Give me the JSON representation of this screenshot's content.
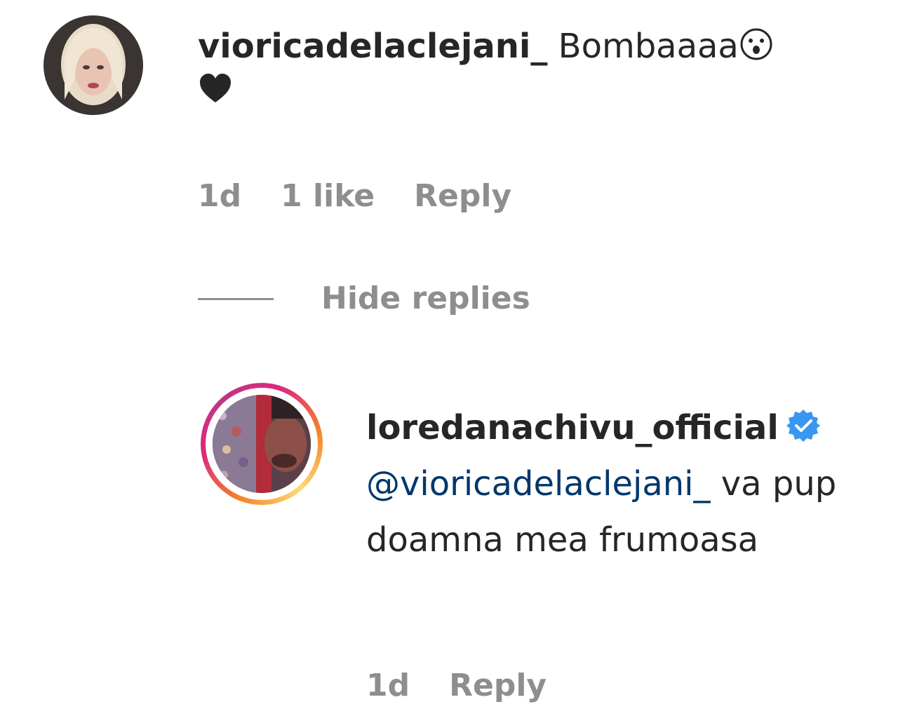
{
  "comment": {
    "username": "vioricadelaclejani_",
    "text": "Bombaaaa",
    "emojis": [
      "astonished-face-icon",
      "black-heart-icon"
    ],
    "time": "1d",
    "likes": "1 like",
    "reply_label": "Reply"
  },
  "hide_replies_label": "Hide replies",
  "reply": {
    "username": "loredanachivu_official",
    "verified": true,
    "mention": "@vioriсadelaclejani_",
    "text": "va pup doamna mea frumoasa",
    "time": "1d",
    "reply_label": "Reply"
  },
  "colors": {
    "text": "#262626",
    "meta": "#8e8e8e",
    "mention": "#00376b",
    "verified": "#3897f0"
  }
}
